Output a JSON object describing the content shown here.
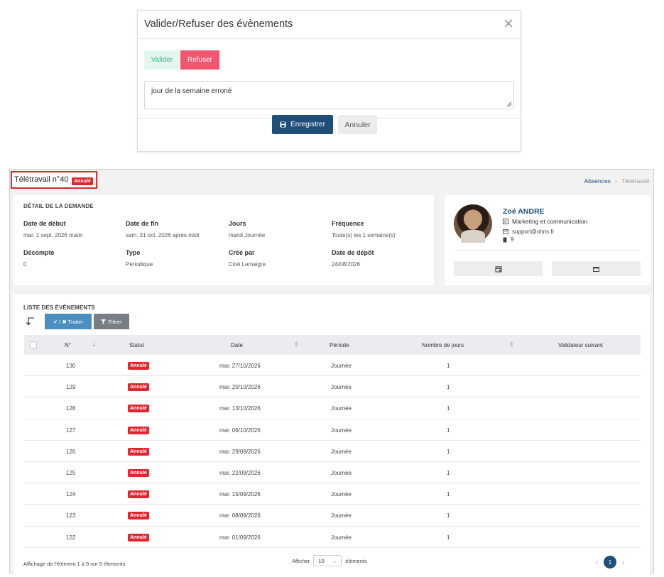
{
  "modal": {
    "title": "Valider/Refuser des évènements",
    "valider_label": "Valider",
    "refuser_label": "Refuser",
    "comment": "jour de la semaine erroné",
    "save_label": "Enregistrer",
    "cancel_label": "Annuler"
  },
  "page": {
    "title": "Télétravail n°40",
    "status_badge": "Annulé",
    "breadcrumb": [
      "Absences",
      "Télétravail"
    ]
  },
  "detail": {
    "section_title": "DÉTAIL DE LA DEMANDE",
    "fields": [
      {
        "label": "Date de début",
        "value": "mar. 1 sept. 2026 matin"
      },
      {
        "label": "Date de fin",
        "value": "sam. 31 oct. 2026 après-midi"
      },
      {
        "label": "Jours",
        "value": "mardi Journée"
      },
      {
        "label": "Fréquence",
        "value": "Toute(s) les 1 semaine(s)"
      },
      {
        "label": "Décompte",
        "value": "0"
      },
      {
        "label": "Type",
        "value": "Périodique"
      },
      {
        "label": "Créé par",
        "value": "Cloé Lemaigre"
      },
      {
        "label": "Date de dépôt",
        "value": "24/08/2026"
      }
    ]
  },
  "profile": {
    "name": "Zoé ANDRE",
    "department": "Marketing et communication",
    "email": "support@ohris.fr",
    "phone": "9"
  },
  "events": {
    "section_title": "LISTE DES ÉVÈNEMENTS",
    "traiter_label": "✔ / ✖ Traiter",
    "filtrer_label": "Filtrer",
    "columns": [
      "N°",
      "Statut",
      "Date",
      "Période",
      "Nombre de jours",
      "Validateur suivant"
    ],
    "rows": [
      {
        "num": "130",
        "status": "Annulé",
        "date": "mar. 27/10/2026",
        "period": "Journée",
        "days": "1"
      },
      {
        "num": "129",
        "status": "Annulé",
        "date": "mar. 20/10/2026",
        "period": "Journée",
        "days": "1"
      },
      {
        "num": "128",
        "status": "Annulé",
        "date": "mar. 13/10/2026",
        "period": "Journée",
        "days": "1"
      },
      {
        "num": "127",
        "status": "Annulé",
        "date": "mar. 06/10/2026",
        "period": "Journée",
        "days": "1"
      },
      {
        "num": "126",
        "status": "Annulé",
        "date": "mar. 29/09/2026",
        "period": "Journée",
        "days": "1"
      },
      {
        "num": "125",
        "status": "Annulé",
        "date": "mar. 22/09/2026",
        "period": "Journée",
        "days": "1"
      },
      {
        "num": "124",
        "status": "Annulé",
        "date": "mar. 15/09/2026",
        "period": "Journée",
        "days": "1"
      },
      {
        "num": "123",
        "status": "Annulé",
        "date": "mar. 08/09/2026",
        "period": "Journée",
        "days": "1"
      },
      {
        "num": "122",
        "status": "Annulé",
        "date": "mar. 01/09/2026",
        "period": "Journée",
        "days": "1"
      }
    ],
    "footer_info": "Affichage de l'élément 1 à 9 sur 9 élements",
    "show_label": "Afficher",
    "page_length": "10",
    "elements_label": "éléments",
    "current_page": "1"
  },
  "colors": {
    "primary": "#1f4e79",
    "danger": "#e0262f",
    "refuser": "#f1566f",
    "valider_bg": "#e4f7ee",
    "traiter": "#4b8fc0",
    "filtrer": "#777e86"
  }
}
